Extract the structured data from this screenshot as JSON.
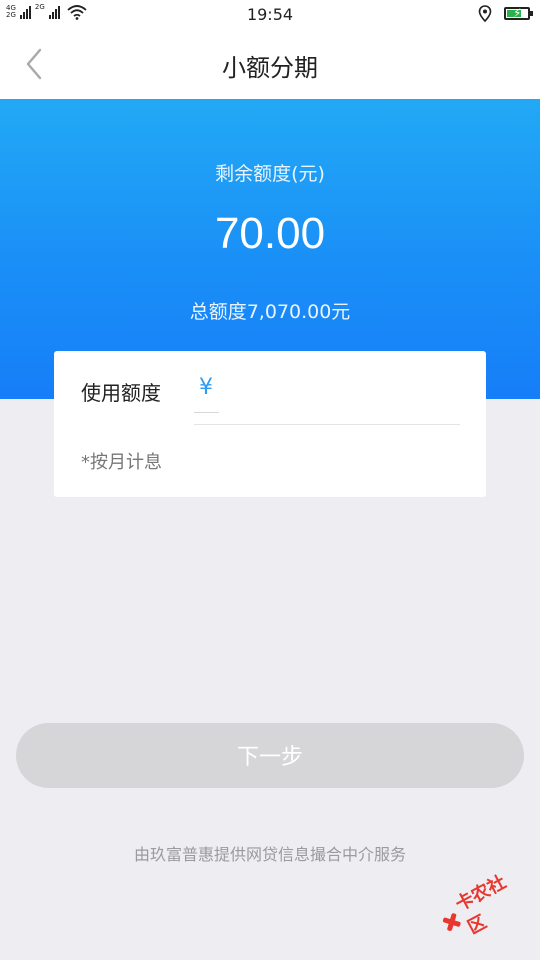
{
  "status_bar": {
    "network_top": "4G",
    "network_bottom": "2G",
    "network2": "2G",
    "time": "19:54",
    "battery_level": 0.8
  },
  "nav": {
    "title": "小额分期"
  },
  "hero": {
    "label": "剩余额度(元)",
    "amount": "70.00",
    "total": "总额度7,070.00元"
  },
  "card": {
    "label": "使用额度",
    "currency": "¥",
    "amount_value": "",
    "note": "*按月计息"
  },
  "next_button": {
    "label": "下一步"
  },
  "footer": {
    "note": "由玖富普惠提供网贷信息撮合中介服务"
  },
  "watermark": {
    "text": "卡农社区"
  },
  "colors": {
    "hero_top": "#22a9f5",
    "hero_bottom": "#167ef8",
    "button_disabled": "#d6d6d9",
    "watermark": "#e8372f"
  }
}
